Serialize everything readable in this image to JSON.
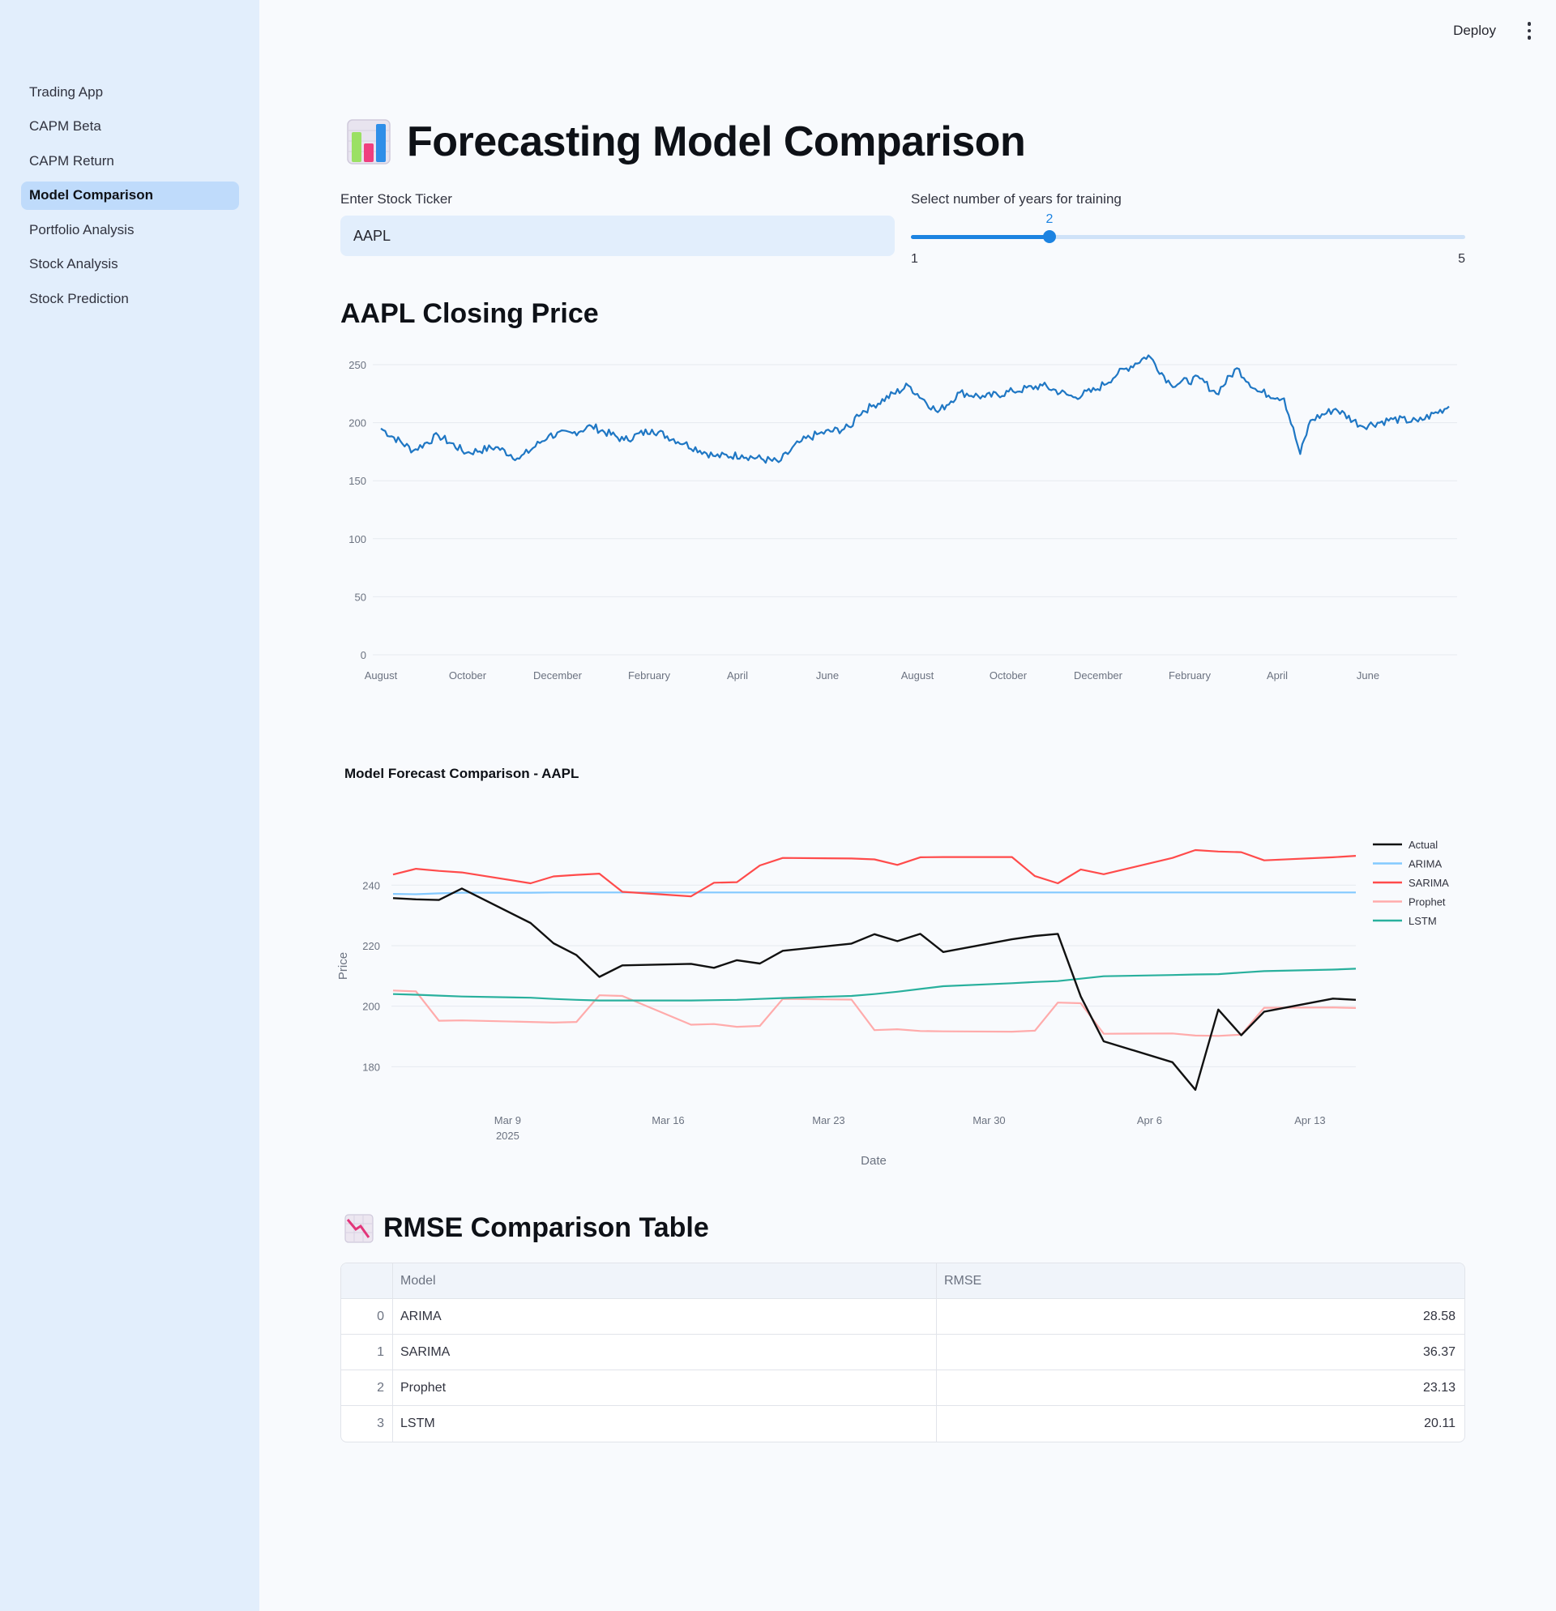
{
  "sidebar": {
    "items": [
      {
        "label": "Trading App",
        "active": false
      },
      {
        "label": "CAPM Beta",
        "active": false
      },
      {
        "label": "CAPM Return",
        "active": false
      },
      {
        "label": "Model Comparison",
        "active": true
      },
      {
        "label": "Portfolio Analysis",
        "active": false
      },
      {
        "label": "Stock Analysis",
        "active": false
      },
      {
        "label": "Stock Prediction",
        "active": false
      }
    ]
  },
  "header": {
    "deploy_label": "Deploy",
    "menu_icon": "kebab-menu-icon"
  },
  "main": {
    "title_icon": "bar-chart-emoji-icon",
    "title": "Forecasting Model Comparison",
    "ticker": {
      "label": "Enter Stock Ticker",
      "value": "AAPL"
    },
    "years_slider": {
      "label": "Select number of years for training",
      "value": 2,
      "min": 1,
      "max": 5
    },
    "closing_title": "AAPL Closing Price",
    "rmse_icon": "chart-decreasing-emoji-icon",
    "rmse_title": "RMSE Comparison Table",
    "table": {
      "headers": {
        "index": "",
        "model": "Model",
        "rmse": "RMSE"
      },
      "rows": [
        {
          "index": "0",
          "model": "ARIMA",
          "rmse": "28.58"
        },
        {
          "index": "1",
          "model": "SARIMA",
          "rmse": "36.37"
        },
        {
          "index": "2",
          "model": "Prophet",
          "rmse": "23.13"
        },
        {
          "index": "3",
          "model": "LSTM",
          "rmse": "20.11"
        }
      ]
    }
  },
  "colors": {
    "accent": "#1c83e1",
    "price_line": "#1f77c4",
    "actual": "#111111",
    "arima": "#83c9ff",
    "sarima": "#ff4b4b",
    "prophet": "#ffabab",
    "lstm": "#29b09d"
  },
  "chart_data": [
    {
      "type": "line",
      "title": "",
      "xlabel": "",
      "ylabel": "",
      "x_tick_labels": [
        "August",
        "October",
        "December",
        "February",
        "April",
        "June",
        "August",
        "October",
        "December",
        "February",
        "April",
        "June"
      ],
      "ylim": [
        0,
        260
      ],
      "y_ticks": [
        0,
        50,
        100,
        150,
        200,
        250
      ],
      "grid": true,
      "series": [
        {
          "x": [
            "2023-07-24",
            "2023-08-15",
            "2023-09-01",
            "2023-09-20",
            "2023-10-10",
            "2023-10-26",
            "2023-11-15",
            "2023-12-01",
            "2023-12-14",
            "2024-01-05",
            "2024-01-24",
            "2024-02-15",
            "2024-03-07",
            "2024-03-25",
            "2024-04-19",
            "2024-05-03",
            "2024-05-15",
            "2024-06-07",
            "2024-06-11",
            "2024-06-21",
            "2024-07-16",
            "2024-08-05",
            "2024-08-20",
            "2024-09-06",
            "2024-09-25",
            "2024-10-15",
            "2024-11-05",
            "2024-11-20",
            "2024-12-05",
            "2024-12-26",
            "2025-01-10",
            "2025-01-30",
            "2025-02-10",
            "2025-02-24",
            "2025-03-10",
            "2025-03-28",
            "2025-04-08",
            "2025-04-15",
            "2025-05-02",
            "2025-05-20",
            "2025-06-10",
            "2025-06-27",
            "2025-07-18"
          ],
          "values": [
            195,
            176,
            189,
            174,
            179,
            169,
            189,
            191,
            197,
            185,
            194,
            182,
            171,
            172,
            166,
            183,
            190,
            196,
            207,
            214,
            232,
            209,
            226,
            222,
            227,
            232,
            222,
            228,
            242,
            258,
            233,
            238,
            225,
            247,
            227,
            221,
            173,
            202,
            212,
            197,
            203,
            201,
            214
          ]
        }
      ]
    },
    {
      "type": "line",
      "title": "Model Forecast Comparison - AAPL",
      "xlabel": "Date",
      "ylabel": "Price",
      "x_tick_labels": [
        "Mar 9\n2025",
        "Mar 16",
        "Mar 23",
        "Mar 30",
        "Apr 6",
        "Apr 13"
      ],
      "ylim": [
        171,
        254
      ],
      "y_ticks": [
        180,
        200,
        220,
        240
      ],
      "grid": true,
      "legend": "top-right",
      "x": [
        "2025-03-04",
        "2025-03-05",
        "2025-03-06",
        "2025-03-07",
        "2025-03-10",
        "2025-03-11",
        "2025-03-12",
        "2025-03-13",
        "2025-03-14",
        "2025-03-17",
        "2025-03-18",
        "2025-03-19",
        "2025-03-20",
        "2025-03-21",
        "2025-03-24",
        "2025-03-25",
        "2025-03-26",
        "2025-03-27",
        "2025-03-28",
        "2025-03-31",
        "2025-04-01",
        "2025-04-02",
        "2025-04-03",
        "2025-04-04",
        "2025-04-07",
        "2025-04-08",
        "2025-04-09",
        "2025-04-10",
        "2025-04-11",
        "2025-04-14",
        "2025-04-15"
      ],
      "series": [
        {
          "name": "Actual",
          "values": [
            235.7,
            235.3,
            235.1,
            238.9,
            227.5,
            220.8,
            216.9,
            209.7,
            213.5,
            214.0,
            212.7,
            215.2,
            214.1,
            218.3,
            220.7,
            223.8,
            221.5,
            223.9,
            217.9,
            222.1,
            223.2,
            223.9,
            203.2,
            188.4,
            181.5,
            172.4,
            198.9,
            190.4,
            198.2,
            202.5,
            202.1
          ]
        },
        {
          "name": "ARIMA",
          "values": [
            237.1,
            237.0,
            237.3,
            237.5,
            237.5,
            237.6,
            237.6,
            237.6,
            237.6,
            237.6,
            237.6,
            237.6,
            237.6,
            237.6,
            237.6,
            237.6,
            237.6,
            237.6,
            237.6,
            237.6,
            237.6,
            237.6,
            237.6,
            237.6,
            237.6,
            237.6,
            237.6,
            237.6,
            237.6,
            237.6,
            237.6
          ]
        },
        {
          "name": "SARIMA",
          "values": [
            243.5,
            245.4,
            244.7,
            244.2,
            240.6,
            242.9,
            243.4,
            243.8,
            237.8,
            236.3,
            240.8,
            241.0,
            246.5,
            249.0,
            248.8,
            248.5,
            246.7,
            249.2,
            249.3,
            249.3,
            243.0,
            240.6,
            245.2,
            243.6,
            249.0,
            251.6,
            251.1,
            250.9,
            248.2,
            249.2,
            249.7
          ]
        },
        {
          "name": "Prophet",
          "values": [
            205.2,
            204.9,
            195.2,
            195.3,
            194.8,
            194.6,
            194.8,
            203.6,
            203.4,
            193.9,
            194.1,
            193.2,
            193.5,
            202.4,
            202.2,
            192.1,
            192.4,
            191.8,
            191.7,
            191.6,
            191.9,
            201.2,
            201.0,
            190.9,
            191.0,
            190.3,
            190.2,
            190.6,
            199.5,
            199.6,
            199.4
          ]
        },
        {
          "name": "LSTM",
          "values": [
            204.0,
            203.8,
            203.5,
            203.2,
            202.8,
            202.4,
            202.1,
            201.9,
            201.9,
            201.9,
            202.0,
            202.1,
            202.4,
            202.7,
            203.4,
            204.0,
            204.8,
            205.7,
            206.6,
            207.6,
            208.0,
            208.3,
            209.1,
            209.9,
            210.3,
            210.5,
            210.6,
            211.1,
            211.6,
            212.1,
            212.4
          ]
        }
      ]
    }
  ]
}
